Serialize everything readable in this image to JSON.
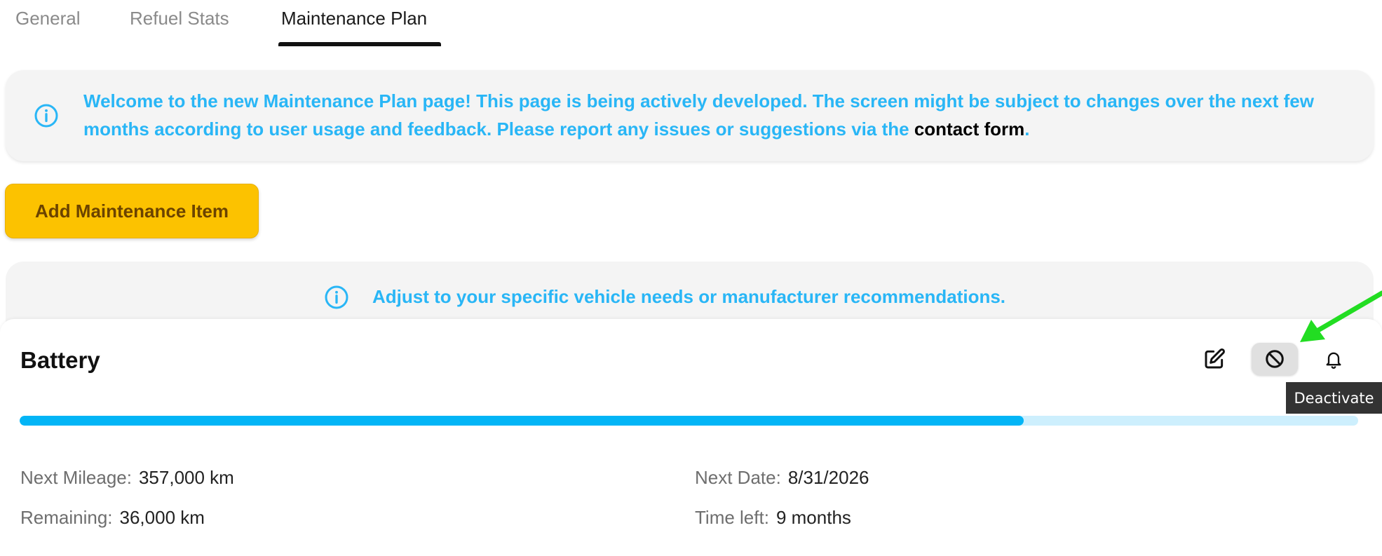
{
  "tabs": [
    {
      "label": "General",
      "active": false
    },
    {
      "label": "Refuel Stats",
      "active": false
    },
    {
      "label": "Maintenance Plan",
      "active": true
    }
  ],
  "banner": {
    "icon": "info-icon",
    "text_before": "Welcome to the new Maintenance Plan page! This page is being actively developed. The screen might be subject to changes over the next few months according to user usage and feedback. Please report any issues or suggestions via the ",
    "link_text": "contact form",
    "text_after": "."
  },
  "add_button": {
    "label": "Add Maintenance Item"
  },
  "hint": {
    "icon": "info-icon",
    "text": "Adjust to your specific vehicle needs or manufacturer recommendations."
  },
  "card": {
    "title": "Battery",
    "actions": [
      {
        "name": "edit",
        "icon": "edit-icon"
      },
      {
        "name": "deactivate",
        "icon": "block-icon"
      },
      {
        "name": "notify",
        "icon": "bell-icon"
      }
    ],
    "tooltip": "Deactivate",
    "progress": 0.75,
    "next_mileage": {
      "label": "Next Mileage:",
      "value": "357,000 km"
    },
    "remaining": {
      "label": "Remaining:",
      "value": "36,000 km"
    },
    "next_date": {
      "label": "Next Date:",
      "value": "8/31/2026"
    },
    "time_left": {
      "label": "Time left:",
      "value": "9 months"
    }
  },
  "colors": {
    "accent_blue": "#29b6f6",
    "progress_fill": "#03b5f6",
    "progress_track": "#cdeffd",
    "button_yellow": "#fcc200",
    "annotation_green": "#22dd22"
  }
}
